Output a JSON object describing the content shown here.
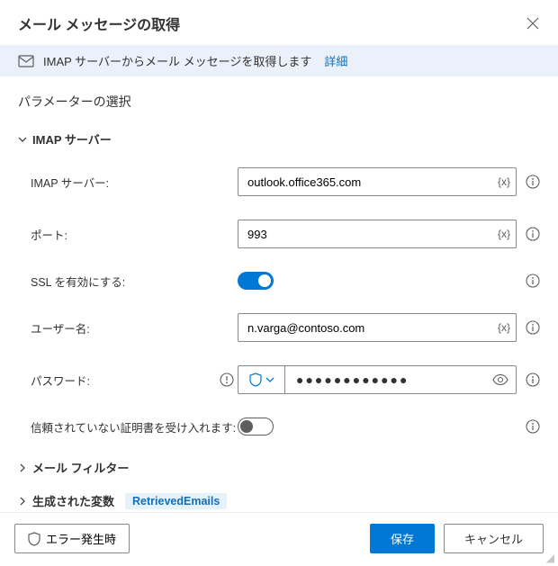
{
  "header": {
    "title": "メール メッセージの取得"
  },
  "banner": {
    "text": "IMAP サーバーからメール メッセージを取得します",
    "details_link": "詳細"
  },
  "section_title": "パラメーターの選択",
  "group": {
    "label": "IMAP サーバー",
    "fields": {
      "server": {
        "label": "IMAP サーバー:",
        "value": "outlook.office365.com",
        "var_token": "{x}"
      },
      "port": {
        "label": "ポート:",
        "value": "993",
        "var_token": "{x}"
      },
      "ssl": {
        "label": "SSL を有効にする:",
        "on": true
      },
      "user": {
        "label": "ユーザー名:",
        "value": "n.varga@contoso.com",
        "var_token": "{x}"
      },
      "password": {
        "label": "パスワード:",
        "masked": "●●●●●●●●●●●●"
      },
      "cert": {
        "label": "信頼されていない証明書を受け入れます:",
        "on": false
      }
    }
  },
  "filter_group": {
    "label": "メール フィルター"
  },
  "output_group": {
    "label": "生成された変数",
    "chip": "RetrievedEmails"
  },
  "footer": {
    "error_button": "エラー発生時",
    "save": "保存",
    "cancel": "キャンセル"
  }
}
